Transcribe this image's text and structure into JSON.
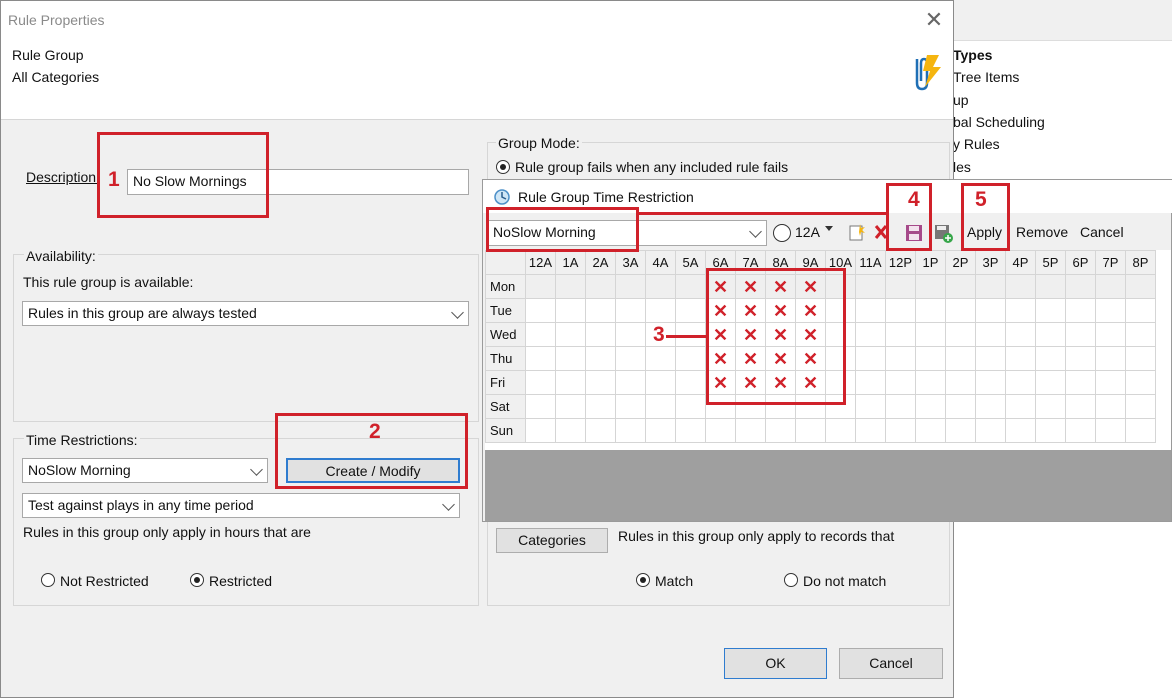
{
  "background_window": {
    "items": [
      "Types",
      "Tree Items",
      "up",
      "bal Scheduling",
      "y Rules",
      "les"
    ]
  },
  "dialog": {
    "title": "Rule Properties",
    "close_glyph": "✕",
    "rule_group_label": "Rule Group",
    "categories_label": "All Categories",
    "description_label": "Description:",
    "description_value": "No Slow Mornings",
    "availability": {
      "group_label": "Availability:",
      "available_label": "This rule group is available:",
      "select_value": "Rules in this group are always tested"
    },
    "time_restrictions": {
      "group_label": "Time Restrictions:",
      "select_value": "NoSlow Morning",
      "create_modify_label": "Create / Modify",
      "period_select": "Test against plays in any time period",
      "note": "Rules in this group only apply in hours that are",
      "not_restricted_label": "Not Restricted",
      "restricted_label": "Restricted",
      "selected": "Restricted"
    },
    "group_mode": {
      "label": "Group Mode:",
      "option": "Rule group fails when any included rule fails"
    },
    "categories_button": "Categories",
    "categories_note": "Rules in this group only apply to records that",
    "match_label": "Match",
    "do_not_match_label": "Do not match",
    "match_selected": "Match",
    "ok_label": "OK",
    "cancel_label": "Cancel"
  },
  "time_restriction_window": {
    "title": "Rule Group Time Restriction",
    "name_value": "NoSlow Morning",
    "time_value": "12A",
    "apply_label": "Apply",
    "remove_label": "Remove",
    "cancel_label": "Cancel",
    "hours": [
      "12A",
      "1A",
      "2A",
      "3A",
      "4A",
      "5A",
      "6A",
      "7A",
      "8A",
      "9A",
      "10A",
      "11A",
      "12P",
      "1P",
      "2P",
      "3P",
      "4P",
      "5P",
      "6P",
      "7P",
      "8P"
    ],
    "days": [
      "Mon",
      "Tue",
      "Wed",
      "Thu",
      "Fri",
      "Sat",
      "Sun"
    ],
    "restricted_cells": {
      "days": [
        "Mon",
        "Tue",
        "Wed",
        "Thu",
        "Fri"
      ],
      "hours": [
        "6A",
        "7A",
        "8A",
        "9A"
      ],
      "mark": "✕"
    }
  },
  "annotations": [
    "1",
    "2",
    "3",
    "4",
    "5"
  ],
  "colors": {
    "annotation": "#d0212a",
    "selection": "#0a78d7"
  },
  "icons": [
    "app-logo-icon",
    "new-icon",
    "delete-icon",
    "save-icon",
    "save-as-icon",
    "clock-icon"
  ]
}
